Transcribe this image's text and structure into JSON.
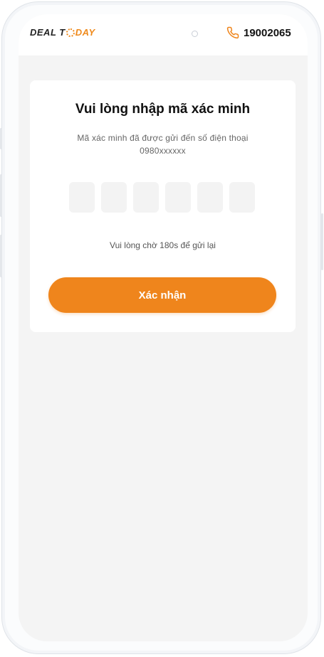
{
  "header": {
    "logo": {
      "part1": "DEAL T",
      "part2": "O",
      "part3": "DAY"
    },
    "phone_number": "19002065",
    "accent": "#ef851c"
  },
  "verify": {
    "title": "Vui lòng nhập mã xác minh",
    "subtitle_line1": "Mã xác minh đã được gửi đến số điện thoại",
    "subtitle_line2": "0980xxxxxx",
    "otp_values": [
      "",
      "",
      "",
      "",
      "",
      ""
    ],
    "wait_text": "Vui lòng chờ 180s để gửi lại",
    "confirm_label": "Xác nhận"
  },
  "icons": [
    "phone-icon",
    "camera-icon"
  ]
}
